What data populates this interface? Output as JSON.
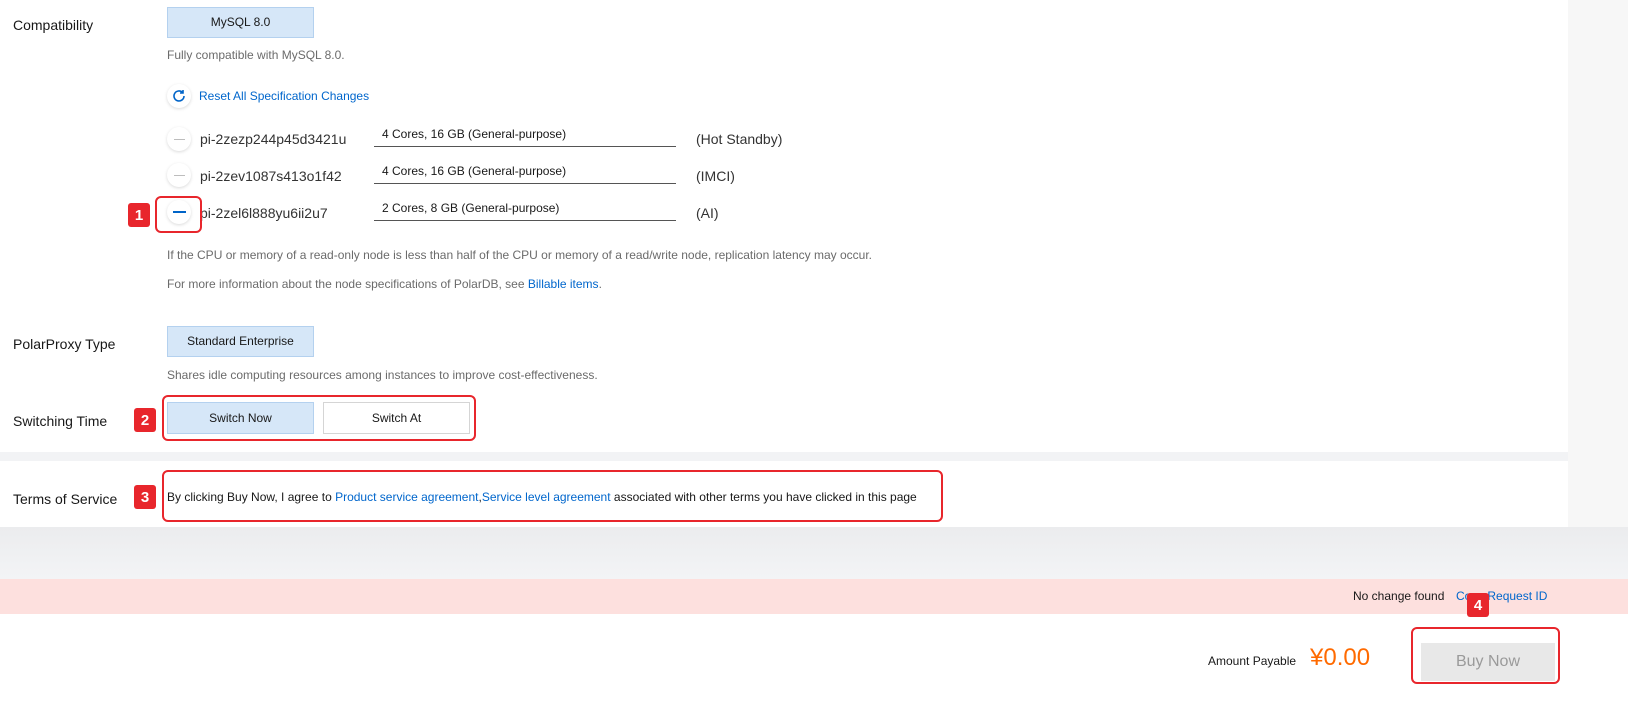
{
  "compatibility": {
    "label": "Compatibility",
    "version_button": "MySQL 8.0",
    "description": "Fully compatible with MySQL 8.0.",
    "reset_link": "Reset All Specification Changes"
  },
  "nodes": [
    {
      "id": "pi-2zezp244p45d3421u",
      "spec": "4 Cores, 16 GB (General-purpose)",
      "role": "(Hot Standby)"
    },
    {
      "id": "pi-2zev1087s413o1f42",
      "spec": "4 Cores, 16 GB (General-purpose)",
      "role": "(IMCI)"
    },
    {
      "id": "pi-2zel6l888yu6ii2u7",
      "spec": "2 Cores, 8 GB (General-purpose)",
      "role": "(AI)"
    }
  ],
  "notes": {
    "latency": "If the CPU or memory of a read-only node is less than half of the CPU or memory of a read/write node, replication latency may occur.",
    "more_info_prefix": "For more information about the node specifications of PolarDB, see ",
    "billable_link": "Billable items",
    "more_info_suffix": "."
  },
  "proxy": {
    "label": "PolarProxy Type",
    "button": "Standard Enterprise",
    "description": "Shares idle computing resources among instances to improve cost-effectiveness."
  },
  "switching": {
    "label": "Switching Time",
    "switch_now": "Switch Now",
    "switch_at": "Switch At"
  },
  "terms": {
    "label": "Terms of Service",
    "prefix": "By clicking Buy Now, I agree to ",
    "link1": "Product service agreement",
    "comma": ",",
    "link2": "Service level agreement",
    "suffix": " associated with other terms you have clicked in this page"
  },
  "status_bar": {
    "message": "No change found",
    "copy_link": "Copy Request ID"
  },
  "footer": {
    "amount_label": "Amount Payable",
    "amount": "¥0.00",
    "buy_button": "Buy Now"
  },
  "annotations": [
    "1",
    "2",
    "3",
    "4"
  ],
  "colors": {
    "accent": "#0066cc",
    "price": "#ff6a00",
    "annotation": "#e8262c",
    "status_bg": "#fde0de"
  }
}
